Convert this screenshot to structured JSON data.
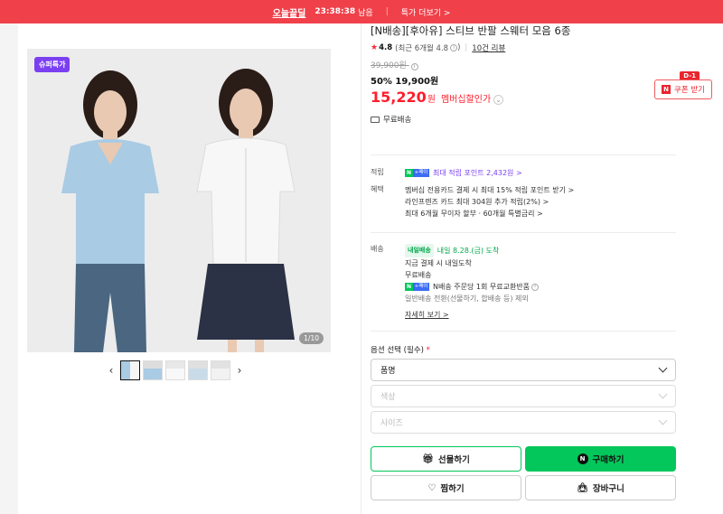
{
  "topbar": {
    "hot_label": "오늘끝딜",
    "timer": "23:38:38",
    "left": "남음",
    "more": "특가 더보기 >"
  },
  "gallery": {
    "badge": "슈퍼특가",
    "counter": "1/10"
  },
  "product": {
    "title": "[N배송][후아유] 스티브 반팔 스웨터 모음 6종",
    "rating": "4.8",
    "rating_recent": "(최근 6개월 4.8",
    "review": "10건 리뷰",
    "orig_price": "39,900원",
    "sale": "50% 19,900원",
    "member_price": "15,220",
    "member_won": "원",
    "member_label": "멤버십할인가",
    "free_ship": "무료배송"
  },
  "coupon": {
    "dday": "D-1",
    "label": "쿠폰 받기"
  },
  "points": {
    "label": "적립",
    "line": "최대 적립 포인트 2,432원 >"
  },
  "benefits": {
    "label": "혜택",
    "lines": [
      "멤버십 전용카드 결제 시 최대 15% 적립 포인트 받기 >",
      "라인프렌즈 카드 최대 304원 추가 적립(2%) >",
      "최대 6개월 무이자 할부 · 60개월 특별금리 >"
    ]
  },
  "delivery": {
    "label": "배송",
    "tomorrow_badge": "내일배송",
    "tomorrow": "내일 8.28.(금) 도착",
    "now_pay": "지금 결제 시 내일도착",
    "free": "무료배송",
    "return": "N배송 주문당 1회 무료교환반품",
    "exclude": "일반배송 전환(선물하기, 합배송 등) 제외",
    "detail": "자세히 보기 >"
  },
  "options": {
    "label": "옵션 선택 (필수)",
    "required_mark": "*",
    "selects": [
      "품명",
      "색상",
      "사이즈"
    ]
  },
  "buttons": {
    "gift": "선물하기",
    "buy": "구매하기",
    "wish": "찜하기",
    "cart": "장바구니"
  }
}
